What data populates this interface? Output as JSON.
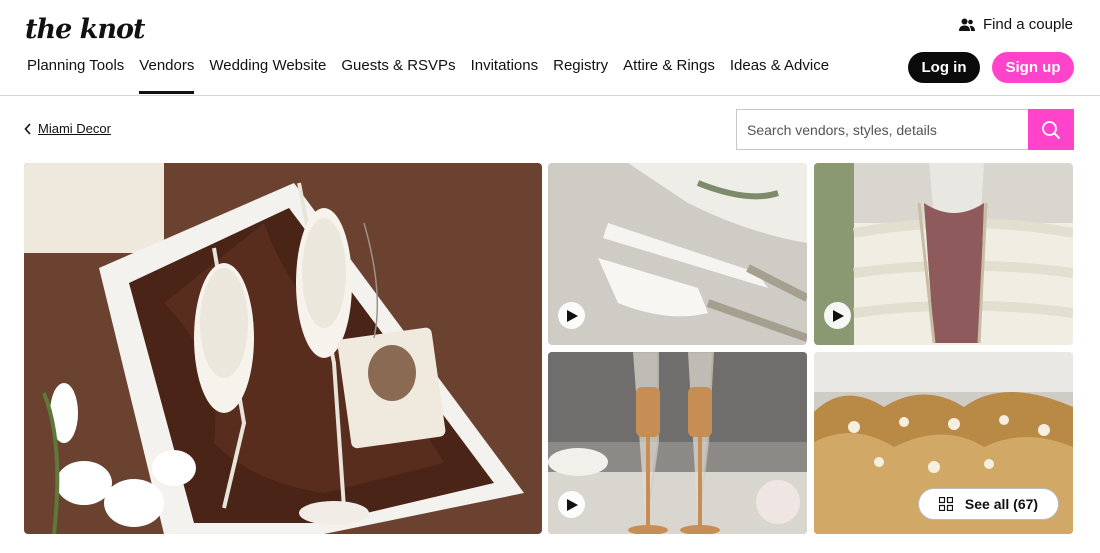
{
  "brand": {
    "logo_text": "the knot",
    "accent": "#ff44cb"
  },
  "header": {
    "find_couple_label": "Find a couple",
    "find_couple_icon": "people-icon",
    "login_label": "Log in",
    "signup_label": "Sign up"
  },
  "nav": {
    "items": [
      {
        "label": "Planning Tools"
      },
      {
        "label": "Vendors",
        "active": true
      },
      {
        "label": "Wedding Website"
      },
      {
        "label": "Guests & RSVPs"
      },
      {
        "label": "Invitations"
      },
      {
        "label": "Registry"
      },
      {
        "label": "Attire & Rings"
      },
      {
        "label": "Ideas & Advice"
      }
    ]
  },
  "breadcrumb": {
    "label": "Miami Decor",
    "icon": "chevron-left-icon"
  },
  "search": {
    "placeholder": "Search vendors, styles, details",
    "value": "",
    "icon": "search-icon"
  },
  "gallery": {
    "photos": [
      {
        "name": "pearl-champagne-flutes-gift-box",
        "video": false
      },
      {
        "name": "engraved-cake-knife-server-set",
        "video": true
      },
      {
        "name": "rose-gold-flute-with-cake",
        "video": true
      },
      {
        "name": "gold-crystal-champagne-flutes",
        "video": true
      },
      {
        "name": "gold-crystal-flute-detail",
        "video": false
      }
    ],
    "see_all_label": "See all (67)",
    "see_all_icon": "grid-icon"
  }
}
